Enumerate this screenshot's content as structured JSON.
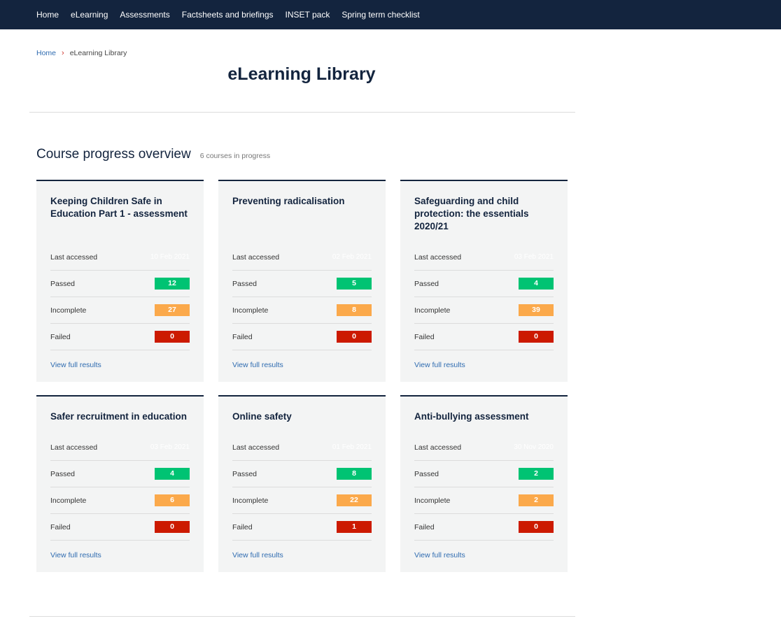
{
  "nav": {
    "items": [
      {
        "label": "Home"
      },
      {
        "label": "eLearning"
      },
      {
        "label": "Assessments"
      },
      {
        "label": "Factsheets and briefings"
      },
      {
        "label": "INSET pack"
      },
      {
        "label": "Spring term checklist"
      }
    ]
  },
  "breadcrumb": {
    "home": "Home",
    "separator": "›",
    "current": "eLearning Library"
  },
  "page": {
    "title": "eLearning Library"
  },
  "overview": {
    "title": "Course progress overview",
    "count": "6 courses in progress",
    "labels": {
      "last_accessed": "Last accessed",
      "passed": "Passed",
      "incomplete": "Incomplete",
      "failed": "Failed",
      "view_link": "View full results"
    },
    "status_colors": {
      "passed": "#00c373",
      "incomplete": "#fba94b",
      "failed": "#cc1a00"
    },
    "courses": [
      {
        "title": "Keeping Children Safe in Education Part 1 - assessment",
        "last_accessed": "10 Feb 2021",
        "passed": "12",
        "incomplete": "27",
        "failed": "0"
      },
      {
        "title": "Preventing radicalisation",
        "last_accessed": "02 Feb 2021",
        "passed": "5",
        "incomplete": "8",
        "failed": "0"
      },
      {
        "title": "Safeguarding and child protection: the essentials 2020/21",
        "last_accessed": "03 Feb 2021",
        "passed": "4",
        "incomplete": "39",
        "failed": "0"
      },
      {
        "title": "Safer recruitment in education",
        "last_accessed": "03 Feb 2021",
        "passed": "4",
        "incomplete": "6",
        "failed": "0"
      },
      {
        "title": "Online safety",
        "last_accessed": "01 Feb 2021",
        "passed": "8",
        "incomplete": "22",
        "failed": "1"
      },
      {
        "title": "Anti-bullying assessment",
        "last_accessed": "30 Nov 2020",
        "passed": "2",
        "incomplete": "2",
        "failed": "0"
      }
    ]
  }
}
